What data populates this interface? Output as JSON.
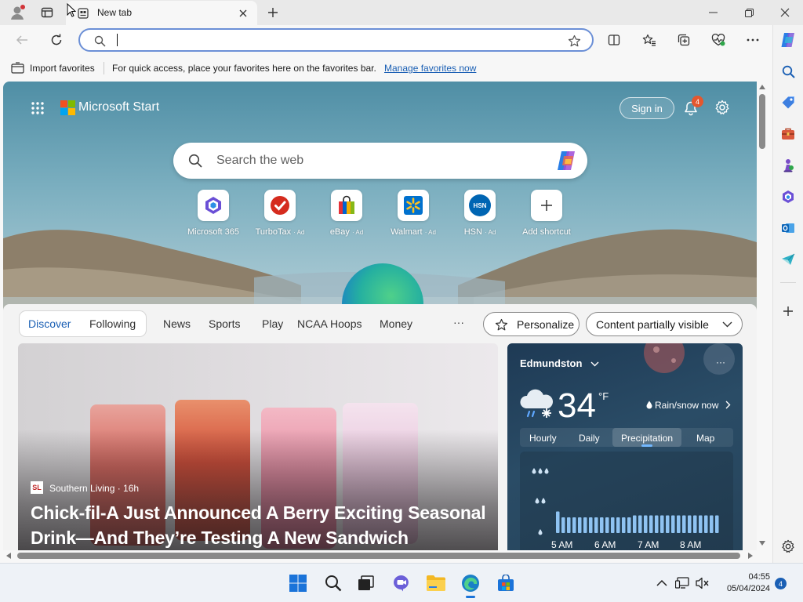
{
  "window": {
    "tab_title": "New tab"
  },
  "toolbar": {
    "address_value": "",
    "address_placeholder": ""
  },
  "favorites_bar": {
    "import_label": "Import favorites",
    "hint": "For quick access, place your favorites here on the favorites bar.",
    "manage_link": "Manage favorites now"
  },
  "page": {
    "brand": "Microsoft Start",
    "sign_in": "Sign in",
    "notification_count": "4",
    "search_placeholder": "Search the web",
    "shortcuts": [
      {
        "label": "Microsoft 365",
        "ad": ""
      },
      {
        "label": "TurboTax",
        "ad": "· Ad"
      },
      {
        "label": "eBay",
        "ad": "· Ad"
      },
      {
        "label": "Walmart",
        "ad": "· Ad"
      },
      {
        "label": "HSN",
        "ad": "· Ad"
      },
      {
        "label": "Add shortcut",
        "ad": ""
      }
    ],
    "hsn_logo_text": "HSN"
  },
  "feed": {
    "tabs": [
      "Discover",
      "Following"
    ],
    "active_tab": "Discover",
    "nav": [
      "News",
      "Sports",
      "Play",
      "NCAA Hoops",
      "Money"
    ],
    "more": "···",
    "personalize": "Personalize",
    "content_visibility": "Content partially visible",
    "hero": {
      "source_logo": "SL",
      "source": "Southern Living · 16h",
      "headline": "Chick-fil-A Just Announced A Berry Exciting Seasonal Drink—And They’re Testing A New Sandwich"
    },
    "weather": {
      "location": "Edmundston",
      "temperature": "34",
      "unit": "°F",
      "condition": "Rain/snow now",
      "tabs": [
        "Hourly",
        "Daily",
        "Precipitation",
        "Map"
      ],
      "active_tab": "Precipitation",
      "more": "···",
      "times": [
        "5 AM",
        "6 AM",
        "7 AM",
        "8 AM"
      ],
      "precip_levels": [
        0.55,
        0.4,
        0.4,
        0.4,
        0.4,
        0.4,
        0.4,
        0.4,
        0.4,
        0.4,
        0.4,
        0.4,
        0.4,
        0.4,
        0.45,
        0.45,
        0.45,
        0.45,
        0.45,
        0.45,
        0.45,
        0.45,
        0.45,
        0.45,
        0.45,
        0.45,
        0.45,
        0.45,
        0.45,
        0.45
      ]
    }
  },
  "taskbar": {
    "time": "04:55",
    "date": "05/04/2024",
    "notification_count": "4"
  }
}
